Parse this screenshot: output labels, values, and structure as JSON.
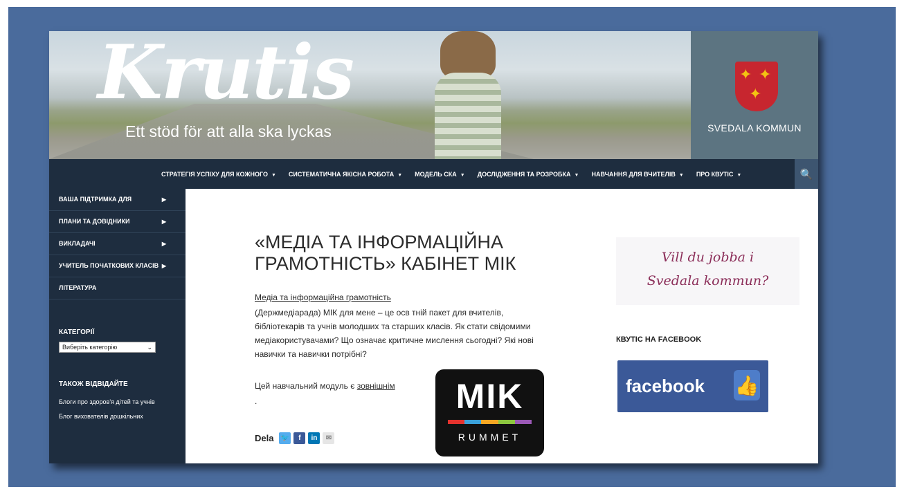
{
  "header": {
    "logo_text": "Krutis",
    "tagline": "Ett stöd för att alla ska lyckas",
    "kommun_name": "SVEDALA KOMMUN"
  },
  "nav": {
    "items": [
      {
        "label": "СТРАТЕГІЯ УСПІХУ ДЛЯ КОЖНОГО"
      },
      {
        "label": "СИСТЕМАТИЧНА ЯКІСНА РОБОТА"
      },
      {
        "label": "МОДЕЛЬ СКА"
      },
      {
        "label": "ДОСЛІДЖЕННЯ ТА РОЗРОБКА"
      },
      {
        "label": "НАВЧАННЯ ДЛЯ ВЧИТЕЛІВ"
      },
      {
        "label": "ПРО КВУТІС"
      }
    ],
    "caret": "▼",
    "search_icon": "🔍"
  },
  "sidebar": {
    "items": [
      {
        "label": "ВАША ПІДТРИМКА ДЛЯ"
      },
      {
        "label": "ПЛАНИ ТА ДОВІДНИКИ"
      },
      {
        "label": "ВИКЛАДАЧІ"
      },
      {
        "label": "УЧИТЕЛЬ ПОЧАТКОВИХ КЛАСІВ"
      },
      {
        "label": "ЛІТЕРАТУРА"
      }
    ],
    "arrow": "▶",
    "categories_title": "КАТЕГОРІЇ",
    "categories_select": "Виберіть категорію",
    "visit_title": "ТАКОЖ ВІДВІДАЙТЕ",
    "visit_links": [
      "Блоги про здоров'я дітей та учнів",
      "Блог вихователів дошкільних"
    ]
  },
  "post": {
    "title": "«МЕДІА ТА ІНФОРМАЦІЙНА ГРАМОТНІСТЬ» КАБІНЕТ МІК",
    "link_text": "Медіа та інформаційна грамотність",
    "body": "(Держмедіарада) МІК для мене – це осв тній пакет для вчителів, бібліотекарів та учнів молодших та старших класів. Як стати свідомими медіакористувачами? Що означає критичне мислення сьогодні? Які нові навички та навички потрібні?",
    "module_prefix": "Цей навчальний модуль є",
    "module_link": "зовнішнім",
    "period": ".",
    "share_label": "Dela",
    "share_twitter": "🐦",
    "share_facebook": "f",
    "share_linkedin": "in",
    "share_email": "✉"
  },
  "mik_logo": {
    "word": "MIK",
    "sub": "RUMMET",
    "bar_colors": [
      "#e5322d",
      "#3aa1da",
      "#f5a623",
      "#8dc63f",
      "#9b59b6"
    ]
  },
  "right": {
    "jobba_line1": "Vill du jobba i",
    "jobba_line2": "Svedala kommun?",
    "fb_title": "КВУТІС НА FACEBOOK",
    "fb_word": "facebook",
    "fb_thumb": "👍"
  },
  "colors": {
    "nav_bg": "#1e2d3f",
    "frame_bg": "#4a6b9c",
    "facebook_blue": "#3b5998",
    "kommun_bg": "#5c7481"
  }
}
